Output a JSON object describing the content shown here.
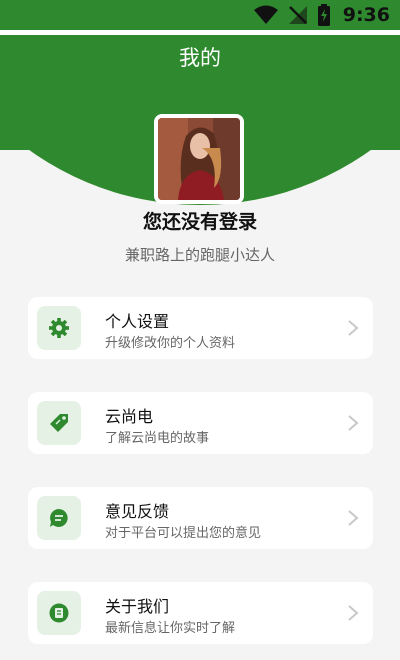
{
  "status_bar": {
    "time": "9:36",
    "icons": [
      "wifi-icon",
      "no-signal-icon",
      "battery-charging-icon"
    ]
  },
  "header": {
    "title": "我的"
  },
  "profile": {
    "avatar": "avatar-photo",
    "name": "您还没有登录",
    "subtitle": "兼职路上的跑腿小达人"
  },
  "menu": {
    "items": [
      {
        "title": "个人设置",
        "subtitle": "升级修改你的个人资料",
        "icon": "gear-icon"
      },
      {
        "title": "云尚电",
        "subtitle": "了解云尚电的故事",
        "icon": "tag-icon"
      },
      {
        "title": "意见反馈",
        "subtitle": "对于平台可以提出您的意见",
        "icon": "chat-bubble-icon"
      },
      {
        "title": "关于我们",
        "subtitle": "最新信息让你实时了解",
        "icon": "info-book-icon"
      }
    ]
  },
  "colors": {
    "brand_green": "#2f8a2f",
    "icon_bg": "#e6f1e6",
    "page_bg": "#f4f4f4"
  }
}
